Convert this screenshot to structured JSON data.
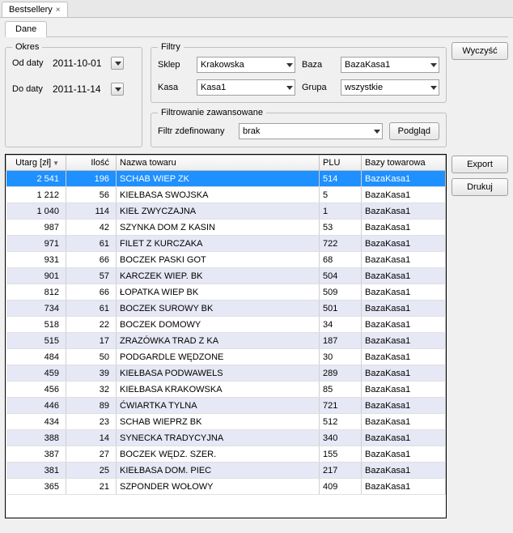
{
  "tab": {
    "title": "Bestsellery",
    "close": "×"
  },
  "inner_tab": "Dane",
  "okres": {
    "legend": "Okres",
    "od_label": "Od daty",
    "od_value": "2011-10-01",
    "do_label": "Do daty",
    "do_value": "2011-11-14"
  },
  "filtry": {
    "legend": "Filtry",
    "sklep_label": "Sklep",
    "sklep_value": "Krakowska",
    "baza_label": "Baza",
    "baza_value": "BazaKasa1",
    "kasa_label": "Kasa",
    "kasa_value": "Kasa1",
    "grupa_label": "Grupa",
    "grupa_value": "wszystkie"
  },
  "adv": {
    "legend": "Filtrowanie zawansowane",
    "label": "Filtr zdefinowany",
    "value": "brak",
    "podglad": "Podgląd"
  },
  "buttons": {
    "wyczysc": "Wyczyść",
    "export": "Export",
    "drukuj": "Drukuj"
  },
  "table": {
    "headers": {
      "utarg": "Utarg [zł]",
      "ilosc": "Ilość",
      "nazwa": "Nazwa towaru",
      "plu": "PLU",
      "bazy": "Bazy towarowa"
    },
    "rows": [
      {
        "utarg": "2 541",
        "ilosc": "196",
        "nazwa": "SCHAB WIEP ZK",
        "plu": "514",
        "bazy": "BazaKasa1",
        "selected": true
      },
      {
        "utarg": "1 212",
        "ilosc": "56",
        "nazwa": "KIEŁBASA SWOJSKA",
        "plu": "5",
        "bazy": "BazaKasa1"
      },
      {
        "utarg": "1 040",
        "ilosc": "114",
        "nazwa": "KIEŁ ZWYCZAJNA",
        "plu": "1",
        "bazy": "BazaKasa1"
      },
      {
        "utarg": "987",
        "ilosc": "42",
        "nazwa": "SZYNKA DOM Z KASIN",
        "plu": "53",
        "bazy": "BazaKasa1"
      },
      {
        "utarg": "971",
        "ilosc": "61",
        "nazwa": "FILET Z KURCZAKA",
        "plu": "722",
        "bazy": "BazaKasa1"
      },
      {
        "utarg": "931",
        "ilosc": "66",
        "nazwa": "BOCZEK PASKI GOT",
        "plu": "68",
        "bazy": "BazaKasa1"
      },
      {
        "utarg": "901",
        "ilosc": "57",
        "nazwa": "KARCZEK WIEP. BK",
        "plu": "504",
        "bazy": "BazaKasa1"
      },
      {
        "utarg": "812",
        "ilosc": "66",
        "nazwa": "ŁOPATKA WIEP BK",
        "plu": "509",
        "bazy": "BazaKasa1"
      },
      {
        "utarg": "734",
        "ilosc": "61",
        "nazwa": "BOCZEK SUROWY BK",
        "plu": "501",
        "bazy": "BazaKasa1"
      },
      {
        "utarg": "518",
        "ilosc": "22",
        "nazwa": "BOCZEK DOMOWY",
        "plu": "34",
        "bazy": "BazaKasa1"
      },
      {
        "utarg": "515",
        "ilosc": "17",
        "nazwa": "ZRAZÓWKA TRAD Z KA",
        "plu": "187",
        "bazy": "BazaKasa1"
      },
      {
        "utarg": "484",
        "ilosc": "50",
        "nazwa": "PODGARDLE WĘDZONE",
        "plu": "30",
        "bazy": "BazaKasa1"
      },
      {
        "utarg": "459",
        "ilosc": "39",
        "nazwa": "KIEŁBASA PODWAWELS",
        "plu": "289",
        "bazy": "BazaKasa1"
      },
      {
        "utarg": "456",
        "ilosc": "32",
        "nazwa": "KIEŁBASA KRAKOWSKA",
        "plu": "85",
        "bazy": "BazaKasa1"
      },
      {
        "utarg": "446",
        "ilosc": "89",
        "nazwa": "ĆWIARTKA TYLNA",
        "plu": "721",
        "bazy": "BazaKasa1"
      },
      {
        "utarg": "434",
        "ilosc": "23",
        "nazwa": "SCHAB WIEPRZ BK",
        "plu": "512",
        "bazy": "BazaKasa1"
      },
      {
        "utarg": "388",
        "ilosc": "14",
        "nazwa": "SYNECKA TRADYCYJNA",
        "plu": "340",
        "bazy": "BazaKasa1"
      },
      {
        "utarg": "387",
        "ilosc": "27",
        "nazwa": "BOCZEK WĘDZ. SZER.",
        "plu": "155",
        "bazy": "BazaKasa1"
      },
      {
        "utarg": "381",
        "ilosc": "25",
        "nazwa": "KIEŁBASA DOM. PIEC",
        "plu": "217",
        "bazy": "BazaKasa1"
      },
      {
        "utarg": "365",
        "ilosc": "21",
        "nazwa": "SZPONDER WOŁOWY",
        "plu": "409",
        "bazy": "BazaKasa1"
      }
    ]
  }
}
